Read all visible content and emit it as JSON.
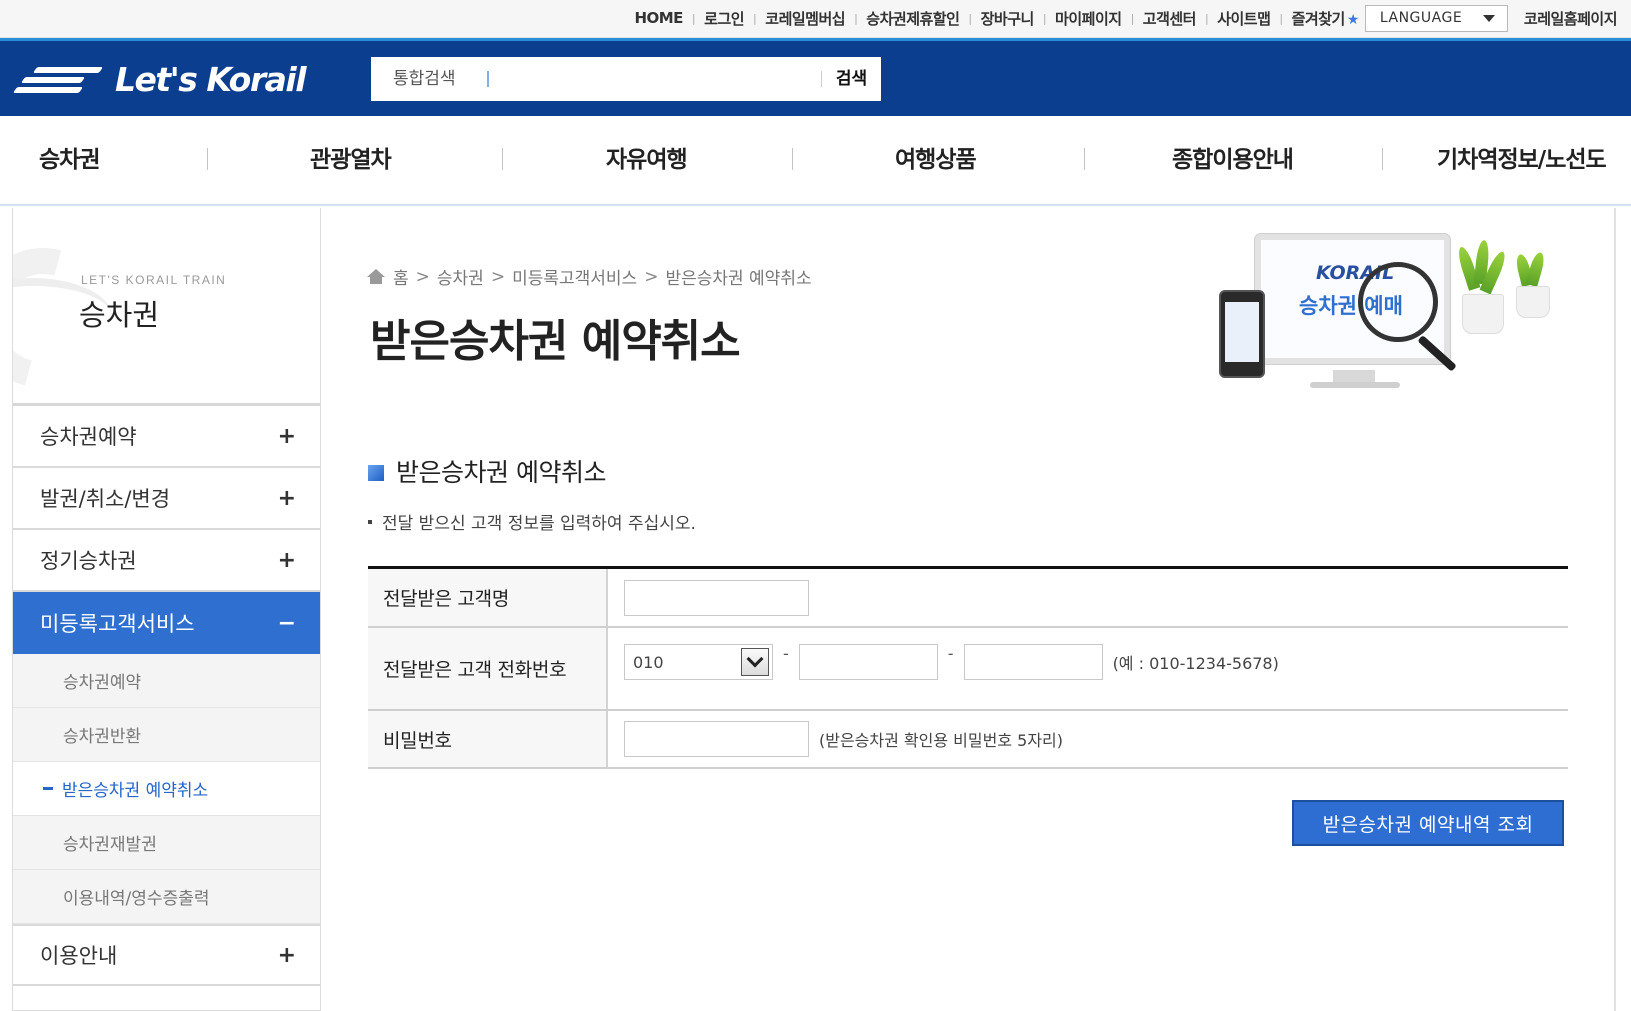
{
  "util_bar": {
    "links": [
      "HOME",
      "로그인",
      "코레일멤버십",
      "승차권제휴할인",
      "장바구니",
      "마이페이지",
      "고객센터",
      "사이트맵",
      "즐겨찾기"
    ],
    "language": "LANGUAGE",
    "homepage": "코레일홈페이지"
  },
  "header": {
    "logo": "Let's Korail",
    "search_label": "통합검색",
    "search_value": "",
    "search_button": "검색"
  },
  "gnb": {
    "items": [
      "승차권",
      "관광열차",
      "자유여행",
      "여행상품",
      "종합이용안내",
      "기차역정보/노선도"
    ]
  },
  "sidebar": {
    "subtitle": "LET'S KORAIL TRAIN",
    "title": "승차권",
    "menu": [
      {
        "label": "승차권예약",
        "toggle": "+"
      },
      {
        "label": "발권/취소/변경",
        "toggle": "+"
      },
      {
        "label": "정기승차권",
        "toggle": "+"
      },
      {
        "label": "미등록고객서비스",
        "toggle": "−"
      }
    ],
    "submenu": [
      "승차권예약",
      "승차권반환",
      "받은승차권 예약취소",
      "승차권재발권",
      "이용내역/영수증출력"
    ],
    "menu_after": {
      "label": "이용안내",
      "toggle": "+"
    }
  },
  "breadcrumb": [
    "홈",
    "승차권",
    "미등록고객서비스",
    "받은승차권 예약취소"
  ],
  "page_title": "받은승차권 예약취소",
  "hero": {
    "brand": "KORAIL",
    "caption": "승차권 예매"
  },
  "section": {
    "title": "받은승차권 예약취소",
    "notice": "전달 받으신 고객 정보를 입력하여 주십시오."
  },
  "form": {
    "name_label": "전달받은 고객명",
    "name_value": "",
    "phone_label": "전달받은 고객 전화번호",
    "phone_prefix": "010",
    "phone_sep": "-",
    "phone_mid": "",
    "phone_last": "",
    "phone_hint": "(예 : 010-1234-5678)",
    "password_label": "비밀번호",
    "password_value": "",
    "password_hint": "(받은승차권 확인용 비밀번호 5자리)"
  },
  "submit_button": "받은승차권 예약내역 조회",
  "colors": {
    "header_bg": "#0b3e8e",
    "active_menu": "#2f6fcf",
    "submit_bg": "#2e6ed3",
    "star": "#3a7be0"
  }
}
